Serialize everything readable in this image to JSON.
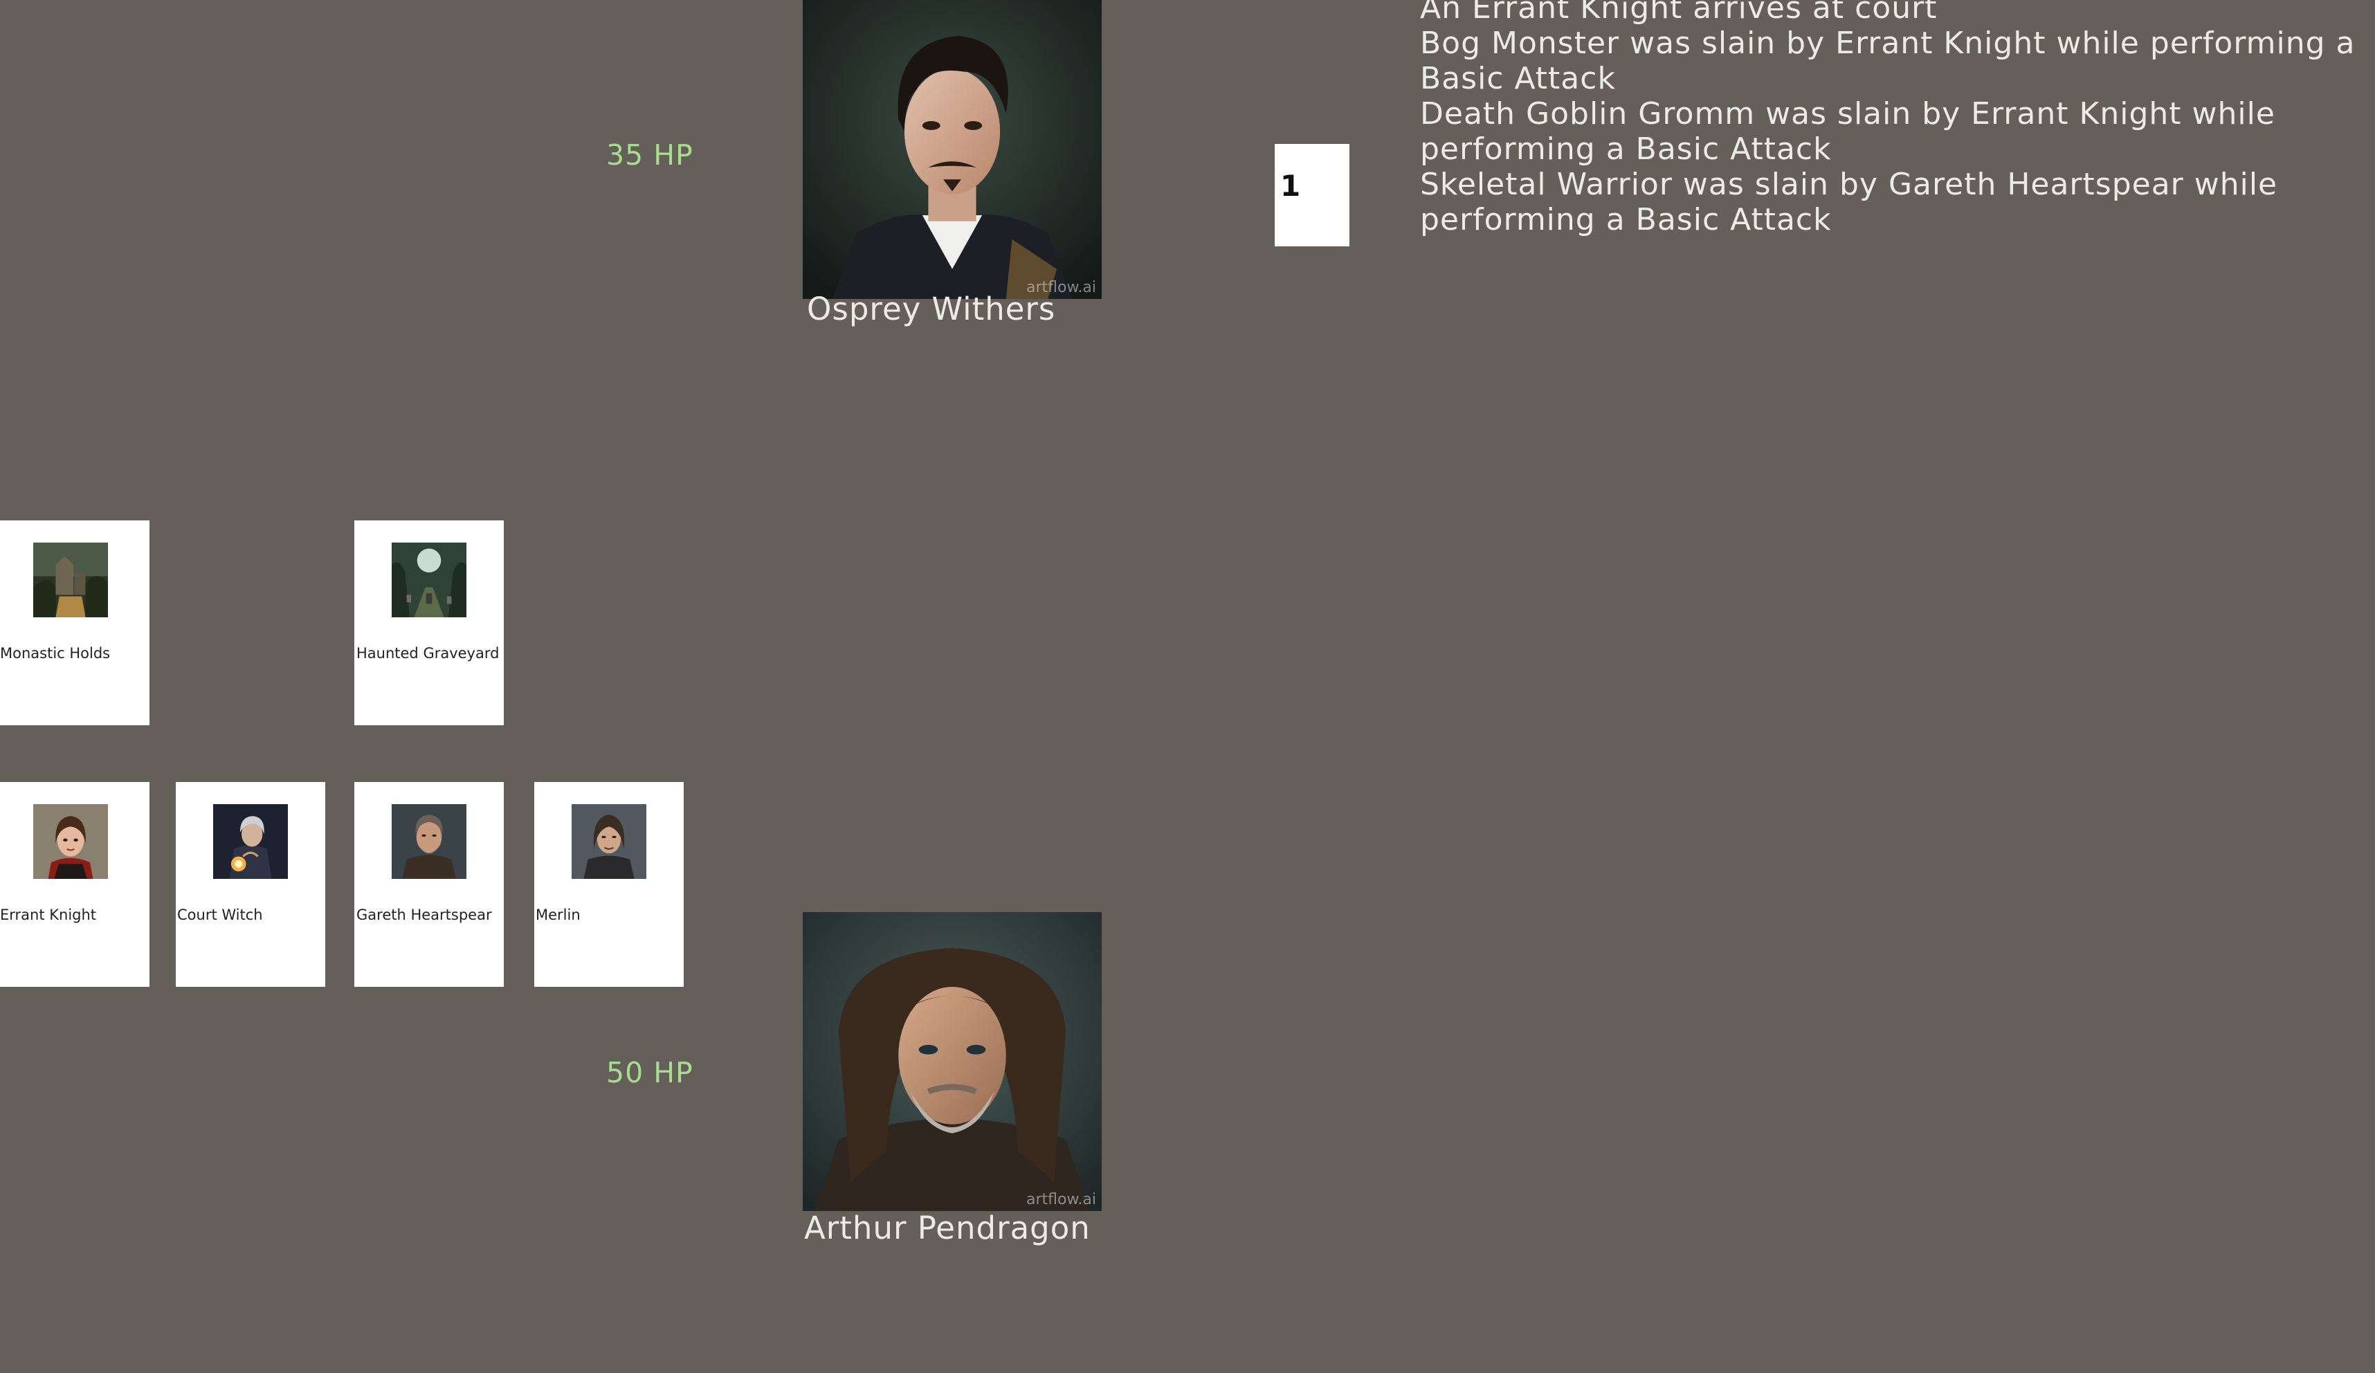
{
  "opponent": {
    "name": "Osprey Withers",
    "hp_label": "35 HP",
    "portrait_icon": "osprey-portrait",
    "watermark": "artflow.ai"
  },
  "player": {
    "name": "Arthur Pendragon",
    "hp_label": "50 HP",
    "portrait_icon": "arthur-portrait",
    "watermark": "artflow.ai"
  },
  "turn": {
    "number": "1"
  },
  "locations": [
    {
      "label": "Monastic Holds",
      "icon": "monastery-icon"
    },
    {
      "label": "Haunted Graveyard",
      "icon": "graveyard-icon"
    }
  ],
  "hand": [
    {
      "label": "Errant Knight",
      "icon": "errant-knight-icon"
    },
    {
      "label": "Court Witch",
      "icon": "court-witch-icon"
    },
    {
      "label": "Gareth Heartspear",
      "icon": "gareth-icon"
    },
    {
      "label": "Merlin",
      "icon": "merlin-icon"
    }
  ],
  "log": {
    "entries": [
      "An Errant Knight arrives at court",
      "Bog Monster was slain by Errant Knight  while performing a Basic Attack",
      "Death Goblin Gromm was slain by Errant Knight  while performing a Basic Attack",
      "Skeletal Warrior was slain by Gareth Heartspear  while performing a Basic Attack"
    ]
  },
  "colors": {
    "background": "#655f5a",
    "hp_text": "#a8dc8e",
    "card_bg": "#ffffff",
    "text_light": "#ecebe8"
  }
}
